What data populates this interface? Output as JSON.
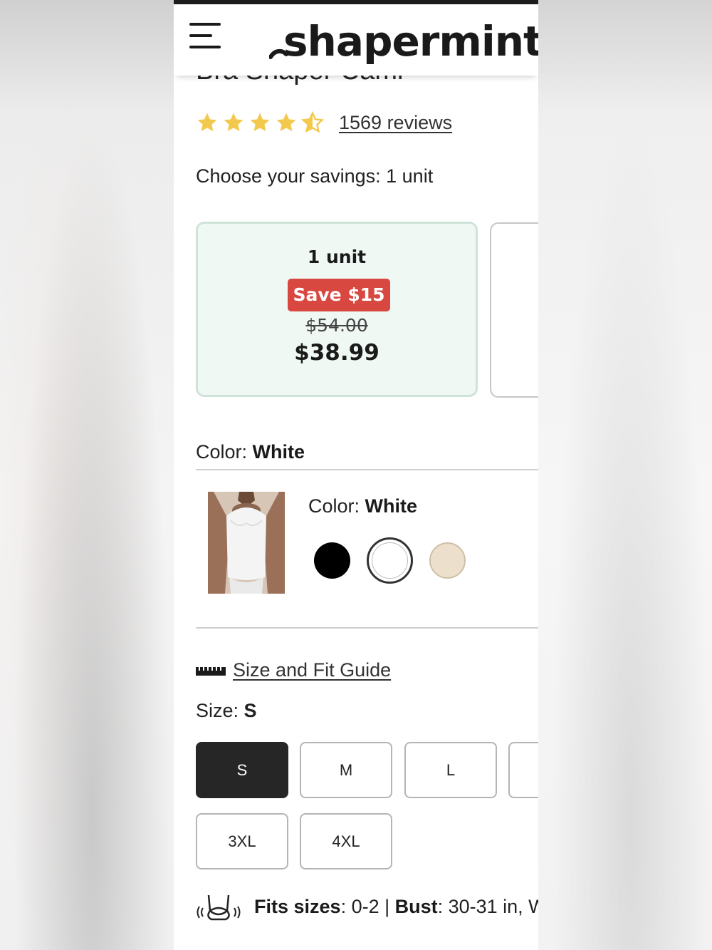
{
  "header": {
    "menu_icon": "hamburger-menu-icon",
    "logo_text": "shapermint"
  },
  "product": {
    "title": "Bra Shaper Cami",
    "rating": 4.5,
    "rating_max": 5,
    "star_color": "#f2c94c",
    "reviews_text": "1569 reviews"
  },
  "savings": {
    "label": "Choose your savings: 1 unit",
    "options": [
      {
        "title": "1 unit",
        "badge": "Save $15",
        "old_price": "$54.00",
        "price": "$38.99",
        "selected": true
      }
    ]
  },
  "color": {
    "label": "Color:",
    "value": "White",
    "inline_label": "Color:",
    "inline_value": "White",
    "swatches": [
      {
        "name": "Black",
        "hex": "#000000",
        "selected": false
      },
      {
        "name": "White",
        "hex": "#ffffff",
        "selected": true
      },
      {
        "name": "Nude",
        "hex": "#ece0cc",
        "selected": false
      }
    ]
  },
  "size": {
    "guide_link": "Size and Fit Guide",
    "label": "Size:",
    "value": "S",
    "options": [
      "S",
      "M",
      "L",
      "3XL",
      "4XL"
    ],
    "selected": "S"
  },
  "fit_info": {
    "fits_label": "Fits sizes",
    "fits_value": ": 0-2 | ",
    "bust_label": "Bust",
    "bust_value": ": 30-31 in, W"
  },
  "colors": {
    "accent_red": "#d94741",
    "card_bg": "#f0f8f4",
    "card_border": "#cfe3d8",
    "selected_size_bg": "#262626"
  }
}
